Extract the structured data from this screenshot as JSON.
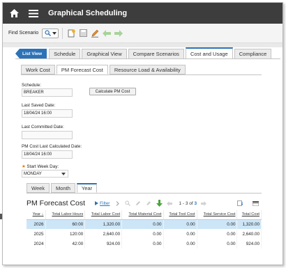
{
  "header": {
    "title": "Graphical Scheduling"
  },
  "toolbar": {
    "find_scenario_label": "Find Scenario"
  },
  "main_tabs": {
    "list_view": "List View",
    "items": [
      "Schedule",
      "Graphical View",
      "Compare Scenarios",
      "Cost and Usage",
      "Compliance"
    ],
    "active": "Cost and Usage"
  },
  "sub_tabs": {
    "items": [
      "Work Cost",
      "PM Forecast Cost",
      "Resource Load & Availability"
    ],
    "active": "PM Forecast Cost"
  },
  "form": {
    "schedule_label": "Schedule:",
    "schedule_value": "BREAKER",
    "calc_button": "Calculate PM Cost",
    "last_saved_label": "Last Saved Date:",
    "last_saved_value": "18/04/24 16:00",
    "last_committed_label": "Last Committed Date:",
    "last_committed_value": "",
    "last_calculated_label": "PM Cost Last Calculated Date:",
    "last_calculated_value": "18/04/24 16:00",
    "start_week_label": "Start Week Day:",
    "start_week_value": "MONDAY"
  },
  "view_tabs": {
    "items": [
      "Week",
      "Month",
      "Year"
    ],
    "active": "Year"
  },
  "cost_panel": {
    "title": "PM Forecast Cost",
    "filter": "Filter",
    "pagination": {
      "prefix": "1 - 3 of",
      "total": "3"
    }
  },
  "grid": {
    "columns": [
      "Year",
      "Total Labor Hours",
      "Total Labor Cost",
      "Total Material Cost",
      "Total Tool Cost",
      "Total Service Cost",
      "Total Cost"
    ],
    "rows": [
      [
        "2026",
        "60:00",
        "1,320.00",
        "0.00",
        "0.00",
        "0.00",
        "1,320.00"
      ],
      [
        "2025",
        "120:00",
        "2,640.00",
        "0.00",
        "0.00",
        "0.00",
        "2,640.00"
      ],
      [
        "2024",
        "42:00",
        "924.00",
        "0.00",
        "0.00",
        "0.00",
        "924.00"
      ]
    ],
    "selected_row": 0
  },
  "colors": {
    "accent": "#2c72b7",
    "titlebar": "#3d3d3d",
    "selected_row": "#cde6f7",
    "required": "#e07b00"
  }
}
